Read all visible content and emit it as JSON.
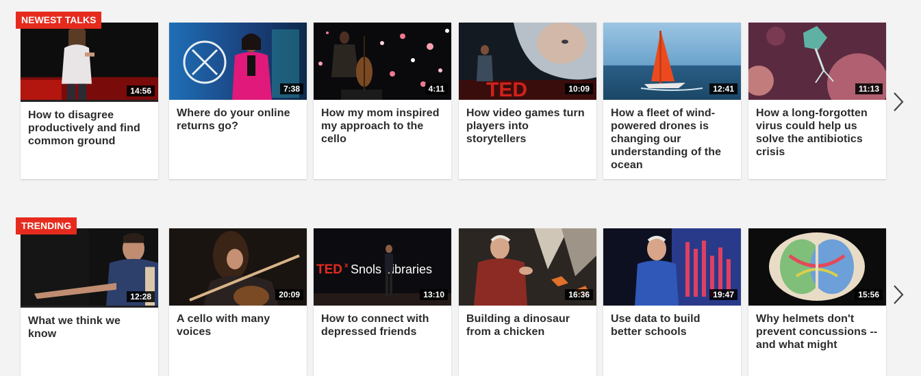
{
  "sections": [
    {
      "label": "NEWEST TALKS",
      "talks": [
        {
          "title": "How to disagree productively and find common ground",
          "duration": "14:56"
        },
        {
          "title": "Where do your online returns go?",
          "duration": "7:38"
        },
        {
          "title": "How my mom inspired my approach to the cello",
          "duration": "4:11"
        },
        {
          "title": "How video games turn players into storytellers",
          "duration": "10:09"
        },
        {
          "title": "How a fleet of wind-powered drones is changing our understanding of the ocean",
          "duration": "12:41"
        },
        {
          "title": "How a long-forgotten virus could help us solve the antibiotics crisis",
          "duration": "11:13"
        }
      ]
    },
    {
      "label": "TRENDING",
      "talks": [
        {
          "title": "What we think we know",
          "duration": "12:28"
        },
        {
          "title": "A cello with many voices",
          "duration": "20:09"
        },
        {
          "title": "How to connect with depressed friends",
          "duration": "13:10"
        },
        {
          "title": "Building a dinosaur from a chicken",
          "duration": "16:36"
        },
        {
          "title": "Use data to build better schools",
          "duration": "19:47"
        },
        {
          "title": "Why helmets don't prevent concussions -- and what might",
          "duration": "15:56"
        }
      ]
    }
  ],
  "thumb_text": {
    "ted_stage": "TED",
    "tedx_brand": "TED",
    "tedx_x": "x",
    "tedx_event": "Snols Libraries"
  },
  "icons": {
    "next": "chevron-right-icon"
  },
  "colors": {
    "accent": "#e62b1e",
    "background": "#f3f3f3",
    "card": "#ffffff",
    "title_text": "#2b2b2b"
  }
}
